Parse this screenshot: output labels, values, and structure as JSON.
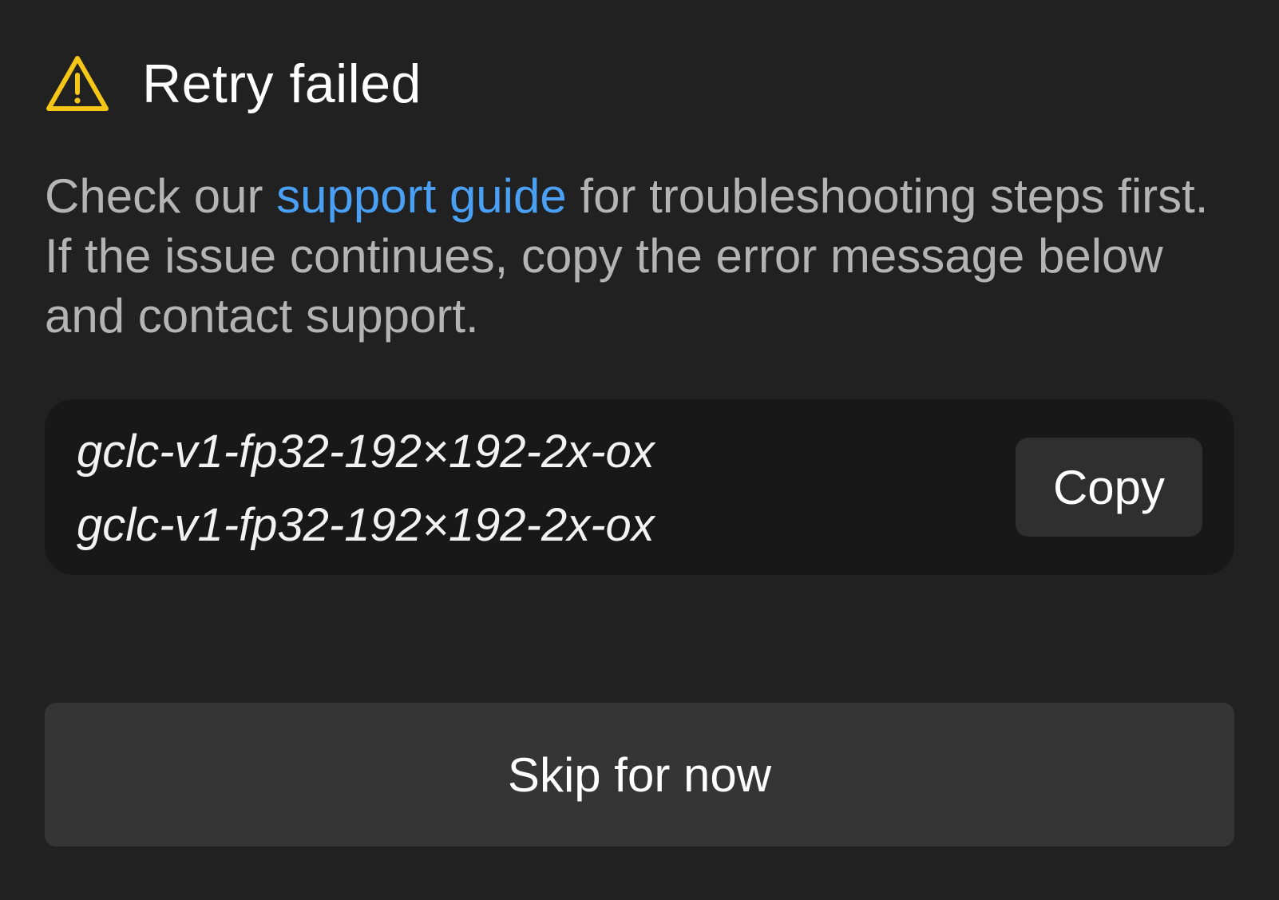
{
  "dialog": {
    "title": "Retry failed",
    "icon": "warning-triangle-icon",
    "icon_color": "#f5c518",
    "description": {
      "before_link": "Check our ",
      "link_text": "support guide",
      "after_link": " for troubleshooting steps first. If the issue continues, copy the error message below and contact support."
    },
    "link_color": "#4aa0f5"
  },
  "error_box": {
    "lines": [
      "gclc-v1-fp32-192×192-2x-ox",
      "gclc-v1-fp32-192×192-2x-ox"
    ],
    "copy_label": "Copy"
  },
  "actions": {
    "skip_label": "Skip for now"
  }
}
